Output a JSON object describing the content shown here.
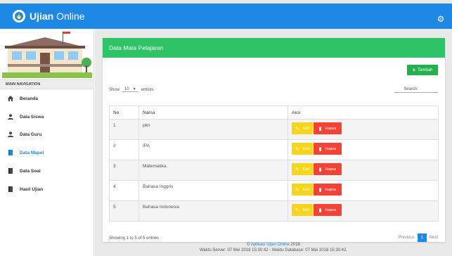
{
  "app": {
    "brand_bold": "Ujian",
    "brand_light": "Online",
    "colors": {
      "primary": "#1e88e5",
      "card_header": "#2fc367",
      "edit": "#f7d51d",
      "delete": "#f44336"
    }
  },
  "sidebar": {
    "nav_header": "MAIN NAVIGATION",
    "items": [
      {
        "label": "Beranda",
        "icon": "home-icon"
      },
      {
        "label": "Data Siswa",
        "icon": "person-icon"
      },
      {
        "label": "Data Guru",
        "icon": "person-icon"
      },
      {
        "label": "Data Mapel",
        "icon": "book-icon",
        "active": true
      },
      {
        "label": "Data Soal",
        "icon": "book-icon"
      },
      {
        "label": "Hasil Ujian",
        "icon": "book-icon"
      }
    ]
  },
  "card": {
    "title": "Data Mata Pelajaran",
    "add_button": "Tambah",
    "show_label": "Show",
    "show_value": "10",
    "entries_label": "entries",
    "search_label": "Search:",
    "search_value": "",
    "columns": [
      "No",
      "Nama",
      "Aksi"
    ],
    "rows": [
      {
        "no": "1",
        "nama": "pkn"
      },
      {
        "no": "2",
        "nama": "IPA"
      },
      {
        "no": "3",
        "nama": "Matematika"
      },
      {
        "no": "4",
        "nama": "Bahasa Inggris"
      },
      {
        "no": "5",
        "nama": "Bahasa Indonesia"
      }
    ],
    "edit_label": "Edit",
    "delete_label": "Hapus",
    "info": "Showing 1 to 5 of 5 entries",
    "pager": {
      "previous": "Previous",
      "current": "1",
      "next": "Next"
    }
  },
  "footer": {
    "copyright_symbol": "©",
    "app_link": "Aplikasi Ujian Online",
    "year": "2018",
    "server_time": "Waktu Server: 07 Mei 2018 15:30:42 - Waktu Database: 07 Mei 2018 15:30:42."
  }
}
